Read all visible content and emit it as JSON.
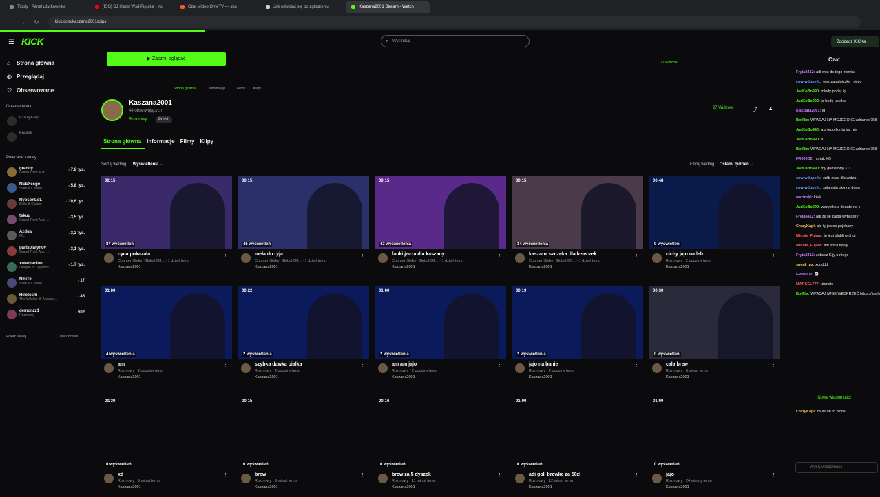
{
  "browser": {
    "tabs": [
      {
        "label": "Tipply | Panel użytkownika",
        "color": "#888888"
      },
      {
        "label": "[ISG] DJ Hazel Wsd Pigulka - Yo",
        "color": "#ff0000"
      },
      {
        "label": "Czat wideo OmeTV — ska",
        "color": "#ff5533"
      },
      {
        "label": "Jak odwołać się po zgłoszeniu",
        "color": "#cccccc"
      },
      {
        "label": "Kaszana2001 Stream - Watch",
        "color": "#53fc18",
        "active": true
      }
    ],
    "url": "kick.com/kaszana2001/clips"
  },
  "header": {
    "logo": "KICK",
    "search_placeholder": "Wyszukaj",
    "get_kick": "Zdobądź KICKa"
  },
  "sidebar": {
    "main": [
      {
        "label": "Strona główna",
        "icon": "home-icon"
      },
      {
        "label": "Przeglądaj",
        "icon": "compass-icon"
      },
      {
        "label": "Obserwowane",
        "icon": "heart-icon"
      }
    ],
    "followed_title": "Obserwowano",
    "followed": [
      {
        "name": "CrazyKapi"
      },
      {
        "name": "Freeze"
      }
    ],
    "recommended_title": "Polecane kanały",
    "recommended": [
      {
        "name": "grendy",
        "game": "Grand Theft Auto ...",
        "viewers": "7,8 tys."
      },
      {
        "name": "NEEXcsgo",
        "game": "Slots & Casino",
        "viewers": "5,8 tys."
      },
      {
        "name": "RybsonLoL",
        "game": "Slots & Casino",
        "viewers": "10,6 tys."
      },
      {
        "name": "takuu",
        "game": "Grand Theft Auto ...",
        "viewers": "3,5 tys."
      },
      {
        "name": "Azdua",
        "game": "IRL",
        "viewers": "3,2 tys."
      },
      {
        "name": "parisplatynov",
        "game": "Grand Theft Auto ...",
        "viewers": "3,1 tys."
      },
      {
        "name": "xntentacion",
        "game": "League of Legends",
        "viewers": "1,7 tys."
      },
      {
        "name": "NikiTel",
        "game": "Slots & Casino",
        "viewers": "17"
      },
      {
        "name": "Hirotoshi",
        "game": "The Witcher 3: Assassi...",
        "viewers": "45"
      },
      {
        "name": "demonzz1",
        "game": "Rozmowy",
        "viewers": "602"
      }
    ],
    "show_more": "Pokaż więcej",
    "show_less": "Pokaż mniej"
  },
  "player": {
    "start_button": "▶ Zacznij oglądać",
    "mini_tabs": [
      "Strona główna",
      "Informacje",
      "Filmy",
      "Klipy"
    ],
    "viewers": "27 Widzów"
  },
  "channel": {
    "name": "Kaszana2001",
    "followers": "44 obserwujących",
    "category": "Rozmowy",
    "language": "Polish",
    "viewers": "27 Widzów",
    "tabs": [
      "Strona główna",
      "Informacje",
      "Filmy",
      "Klipy"
    ]
  },
  "sort": {
    "label": "Sortuj według:",
    "value": "Wyświetlenia",
    "filter_label": "Filtruj według:",
    "filter_value": "Ostatni tydzień"
  },
  "clips": [
    {
      "duration": "00:15",
      "views": "87 wyświetleń",
      "title": "cyca pokazała",
      "sub": "Counter-Strike: Global Off... · 1 dzień temu",
      "author": "Kaszana2001",
      "bg": "#3a2a6a"
    },
    {
      "duration": "00:15",
      "views": "45 wyświetleń",
      "title": "mela do ryja",
      "sub": "Counter-Strike: Global Off... · 1 dzień temu",
      "author": "Kaszana2001",
      "bg": "#2b2f6a"
    },
    {
      "duration": "00:15",
      "views": "43 wyświetlenia",
      "title": "fanki jecza dla kaszany",
      "sub": "Counter-Strike: Global Off... · 1 dzień temu",
      "author": "Kaszana2001",
      "bg": "#5a2a8a"
    },
    {
      "duration": "00:15",
      "views": "34 wyświetlenia",
      "title": "kaszana szczeka dla laseczek",
      "sub": "Counter-Strike: Global Off... · 1 dzień temu",
      "author": "Kaszana2001",
      "bg": "#4a3a4a"
    },
    {
      "duration": "00:48",
      "views": "9 wyświetleń",
      "title": "cichy jajo na leb",
      "sub": "Rozmowy · 2 godziny temu",
      "author": "Kaszana2001",
      "bg": "#0a1a4a"
    },
    {
      "duration": "01:00",
      "views": "4 wyświetlenia",
      "title": "am",
      "sub": "Rozmowy · 2 godziny temu",
      "author": "Kaszana2001",
      "bg": "#0a1a5a"
    },
    {
      "duration": "00:22",
      "views": "2 wyświetlenia",
      "title": "szybka dawka bialka",
      "sub": "Rozmowy · 2 godziny temu",
      "author": "Kaszana2001",
      "bg": "#0a1a5a"
    },
    {
      "duration": "01:00",
      "views": "2 wyświetlenia",
      "title": "am am jajo",
      "sub": "Rozmowy · 2 godziny temu",
      "author": "Kaszana2001",
      "bg": "#0a1a5a"
    },
    {
      "duration": "00:19",
      "views": "2 wyświetlenia",
      "title": "jajo na banie",
      "sub": "Rozmowy · 2 godziny temu",
      "author": "Kaszana2001",
      "bg": "#0a1a5a"
    },
    {
      "duration": "00:30",
      "views": "0 wyświetleń",
      "title": "cala brew",
      "sub": "Rozmowy · 6 minut temu",
      "author": "Kaszana2001",
      "bg": "#2a2a3a"
    },
    {
      "duration": "00:30",
      "views": "0 wyświetleń",
      "title": "xd",
      "sub": "Rozmowy · 9 minut temu",
      "author": "Kaszana2001",
      "bg": "#0b0b0d"
    },
    {
      "duration": "00:15",
      "views": "0 wyświetleń",
      "title": "brew",
      "sub": "Rozmowy · 9 minut temu",
      "author": "Kaszana2001",
      "bg": "#0b0b0d"
    },
    {
      "duration": "00:16",
      "views": "0 wyświetleń",
      "title": "brew za 5 dyszek",
      "sub": "Rozmowy · 11 minut temu",
      "author": "Kaszana2001",
      "bg": "#0b0b0d"
    },
    {
      "duration": "01:00",
      "views": "0 wyświetleń",
      "title": "adi goli brewke za 50zl",
      "sub": "Rozmowy · 12 minut temu",
      "author": "Kaszana2001",
      "bg": "#0b0b0d"
    },
    {
      "duration": "01:00",
      "views": "0 wyświetleń",
      "title": "jajo",
      "sub": "Rozmowy · 24 minuty temu",
      "author": "Kaszana2001",
      "bg": "#0b0b0d"
    }
  ],
  "chat": {
    "title": "Czat",
    "messages": [
      {
        "user": "Fryta8412:",
        "text": " adi wez dc tego ziomka",
        "color": "#c780ff"
      },
      {
        "user": "cowiwdupeiIc:",
        "text": " wez zapalniczkę i dezo",
        "color": "#6b9bff"
      },
      {
        "user": "JacKoBo990:",
        "text": " mlody podaj ig",
        "color": "#53fc18"
      },
      {
        "user": "JacKoBo990:",
        "text": " ja będę ucieka!",
        "color": "#53fc18"
      },
      {
        "user": "Kaszana2001:",
        "text": " ig",
        "color": "#c780ff"
      },
      {
        "user": "BotRix:",
        "text": " WPADAJ NA MOJEGO IG:adrianeq758",
        "color": "#53fc18"
      },
      {
        "user": "JacKoBo990:",
        "text": " a z tego konta już nie",
        "color": "#53fc18"
      },
      {
        "user": "JacKoBo990:",
        "text": " XD",
        "color": "#53fc18"
      },
      {
        "user": "BotRix:",
        "text": " WPADAJ NA MOJEGO IG:adrianeq758",
        "color": "#53fc18"
      },
      {
        "user": "FR000D2:",
        "text": " no tak XD",
        "color": "#c780ff"
      },
      {
        "user": "JacKoBo990:",
        "text": " my godzilowy XD",
        "color": "#53fc18"
      },
      {
        "user": "cowiwdupeiIc:",
        "text": " zrób zeza dla widza",
        "color": "#6b9bff"
      },
      {
        "user": "cowiwdupeiIc:",
        "text": " splaniala oko na dupa",
        "color": "#6b9bff"
      },
      {
        "user": "wazinski:",
        "text": " kijek",
        "color": "#c780ff"
      },
      {
        "user": "JacKoBo990:",
        "text": " wszystko z donate na c",
        "color": "#53fc18"
      },
      {
        "user": "Fryta8412:",
        "text": " adi za ile zajda wybijasz?",
        "color": "#c780ff"
      },
      {
        "user": "CrazyKapi:",
        "text": " ale ty jestes pojebany",
        "color": "#ffc85a"
      },
      {
        "user": "Minnie_Fujara:",
        "text": " to jest dlubli w chuj",
        "color": "#ff5a5a"
      },
      {
        "user": "Minnie_Fujara:",
        "text": " adi poka tipply",
        "color": "#ff5a5a"
      },
      {
        "user": "Fryta8412:",
        "text": " zobacz Kljy u niego",
        "color": "#c780ff"
      },
      {
        "user": "sneak_ax:",
        "text": " xddddd",
        "color": "#ffc85a"
      },
      {
        "user": "FR000D2:",
        "text": " 🅱",
        "color": "#c780ff"
      },
      {
        "user": "MARCEL777:",
        "text": " tdonate",
        "color": "#ff5a5a"
      },
      {
        "user": "BotRix:",
        "text": " WPADAJ MNIE WESPRZEĆ https://tipply.pl/@kaszana",
        "color": "#53fc18"
      }
    ],
    "new_messages": "Nowe wiadomości",
    "last": {
      "user": "CrazyKapi:",
      "text": " za ile on to zrobił",
      "color": "#ffc85a"
    },
    "input_placeholder": "Wyślij wiadomość"
  }
}
